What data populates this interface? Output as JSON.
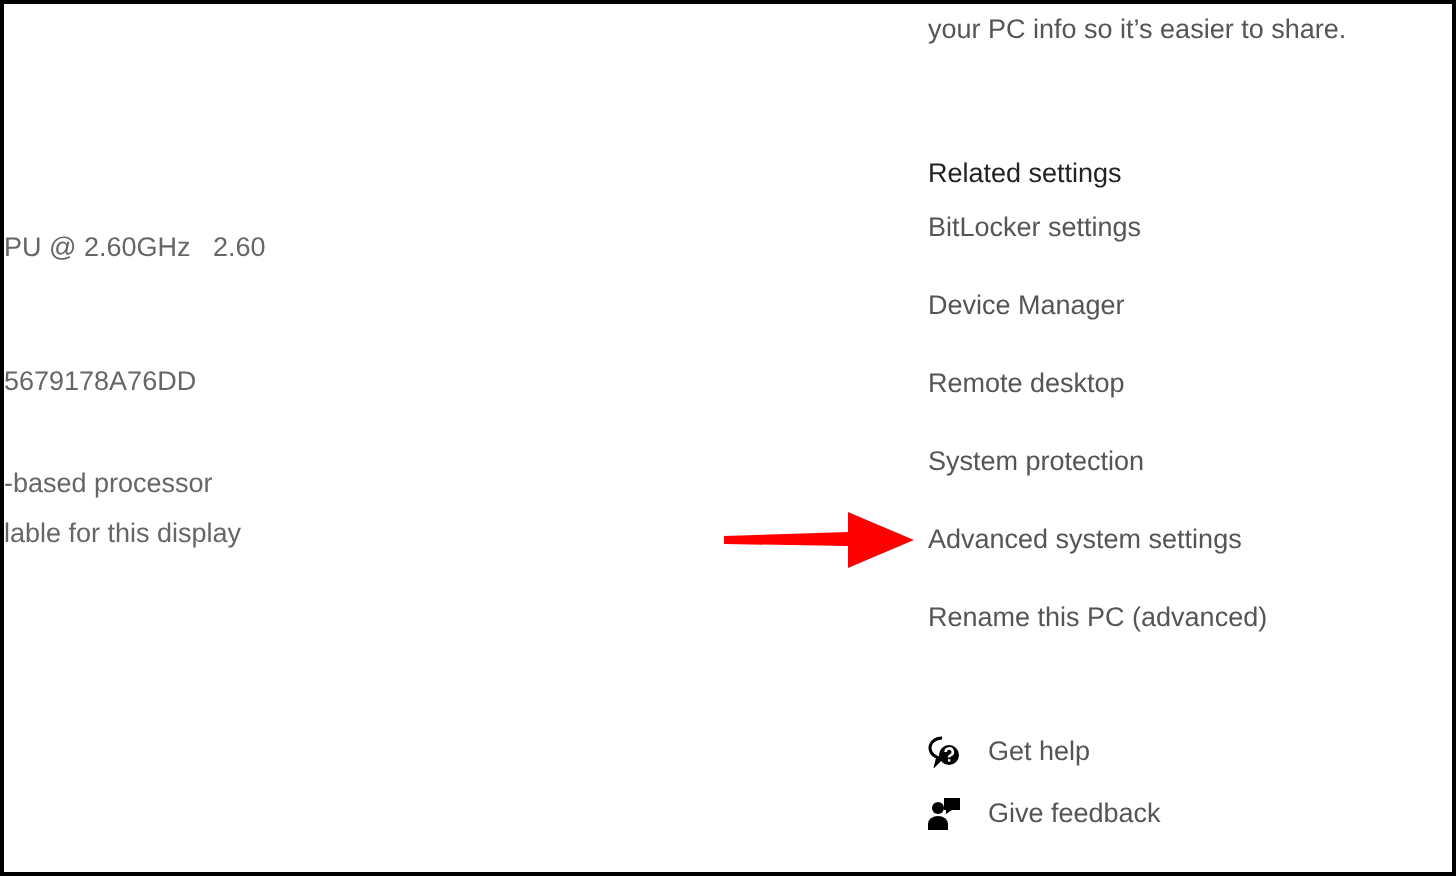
{
  "specs_cut": [
    "PU @ 2.60GHz   2.60",
    "5679178A76DD",
    "-based processor",
    "lable for this display"
  ],
  "copy_note": "your PC info so it’s easier to share.",
  "related_settings": {
    "heading": "Related settings",
    "links": [
      "BitLocker settings",
      "Device Manager",
      "Remote desktop",
      "System protection",
      "Advanced system settings",
      "Rename this PC (advanced)"
    ]
  },
  "support": [
    {
      "kind": "help",
      "label": "Get help"
    },
    {
      "kind": "feedback",
      "label": "Give feedback"
    }
  ]
}
